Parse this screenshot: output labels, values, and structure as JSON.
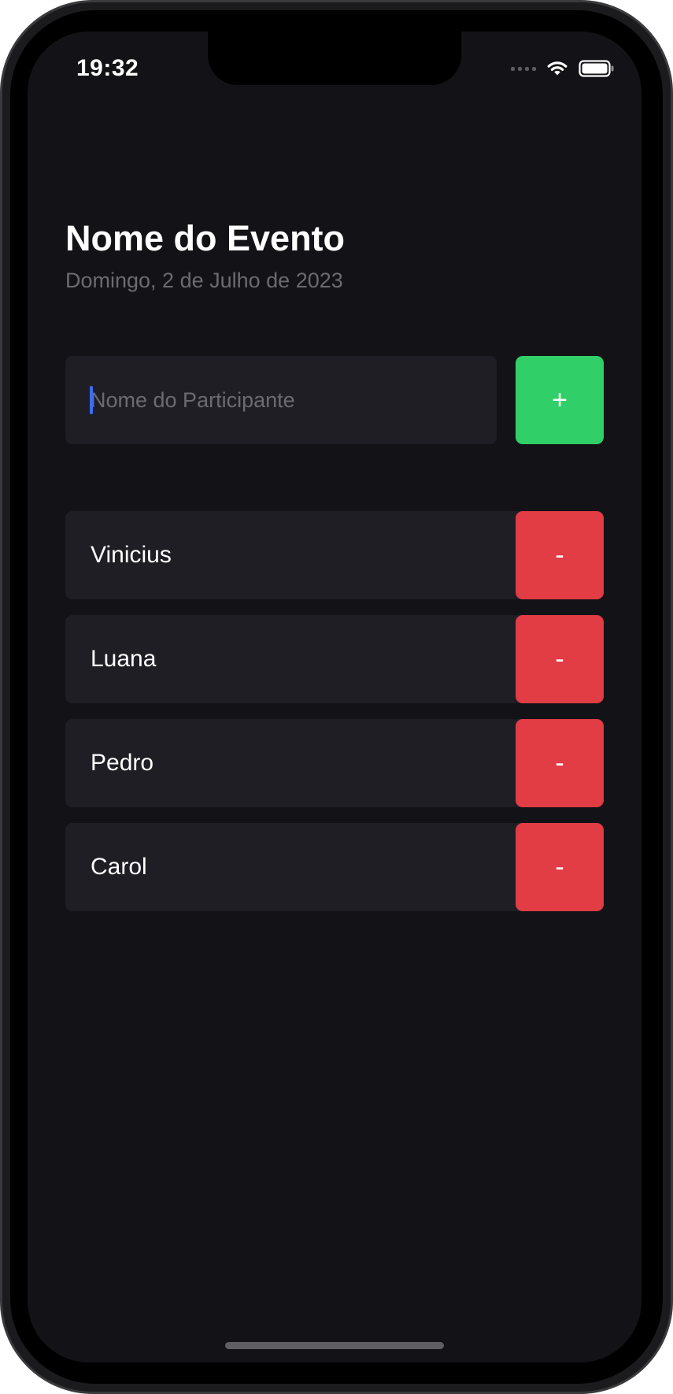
{
  "status_bar": {
    "time": "19:32"
  },
  "event": {
    "title": "Nome do Evento",
    "date": "Domingo, 2 de Julho de 2023"
  },
  "form": {
    "input_placeholder": "Nome do Participante",
    "input_value": "",
    "add_label": "+"
  },
  "participants": [
    {
      "name": "Vinicius",
      "remove_label": "-"
    },
    {
      "name": "Luana",
      "remove_label": "-"
    },
    {
      "name": "Pedro",
      "remove_label": "-"
    },
    {
      "name": "Carol",
      "remove_label": "-"
    }
  ],
  "colors": {
    "background": "#131216",
    "card": "#1f1e25",
    "add_button": "#31cf67",
    "remove_button": "#e23c44",
    "caret": "#3b6df5",
    "muted_text": "#6b6b70"
  },
  "icons": {
    "signal": "cellular-signal-icon",
    "wifi": "wifi-icon",
    "battery": "battery-icon"
  }
}
